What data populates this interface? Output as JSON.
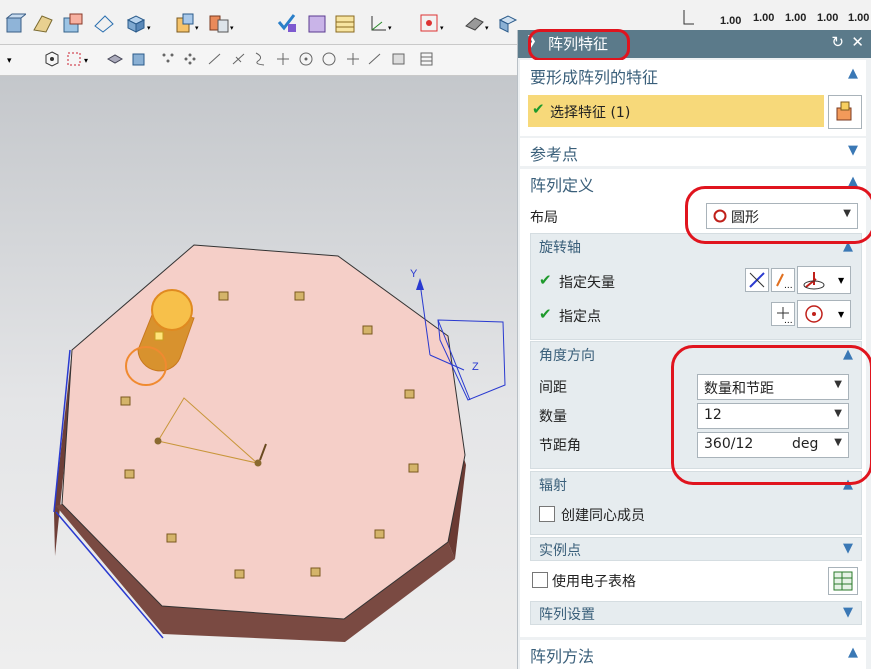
{
  "toolbar_right": {
    "values": [
      "1.00",
      "1.00",
      "1.00",
      "1.00",
      "1.00"
    ]
  },
  "dialog": {
    "title": "阵列特征",
    "sections": {
      "features": {
        "title": "要形成阵列的特征",
        "select_label": "选择特征 (1)"
      },
      "reference": {
        "title": "参考点"
      },
      "definition": {
        "title": "阵列定义",
        "layout_label": "布局",
        "layout_value": "圆形",
        "rotation_axis": {
          "title": "旋转轴",
          "vector_label": "指定矢量",
          "point_label": "指定点"
        },
        "angle_direction": {
          "title": "角度方向",
          "spacing_label": "间距",
          "spacing_value": "数量和节距",
          "count_label": "数量",
          "count_value": "12",
          "pitch_label": "节距角",
          "pitch_value": "360/12",
          "pitch_unit": "deg"
        },
        "radiation": {
          "title": "辐射",
          "concentric_label": "创建同心成员"
        },
        "instance_points": {
          "title": "实例点"
        },
        "spreadsheet_label": "使用电子表格",
        "settings": {
          "title": "阵列设置"
        }
      },
      "method": {
        "title": "阵列方法"
      }
    }
  },
  "viewport": {
    "axis_y": "Y",
    "axis_z": "Z"
  },
  "colors": {
    "title_bar": "#5b7a8a",
    "highlight": "#f7d97a",
    "annotation": "#e0141e",
    "plate": "#f5cfc8"
  }
}
